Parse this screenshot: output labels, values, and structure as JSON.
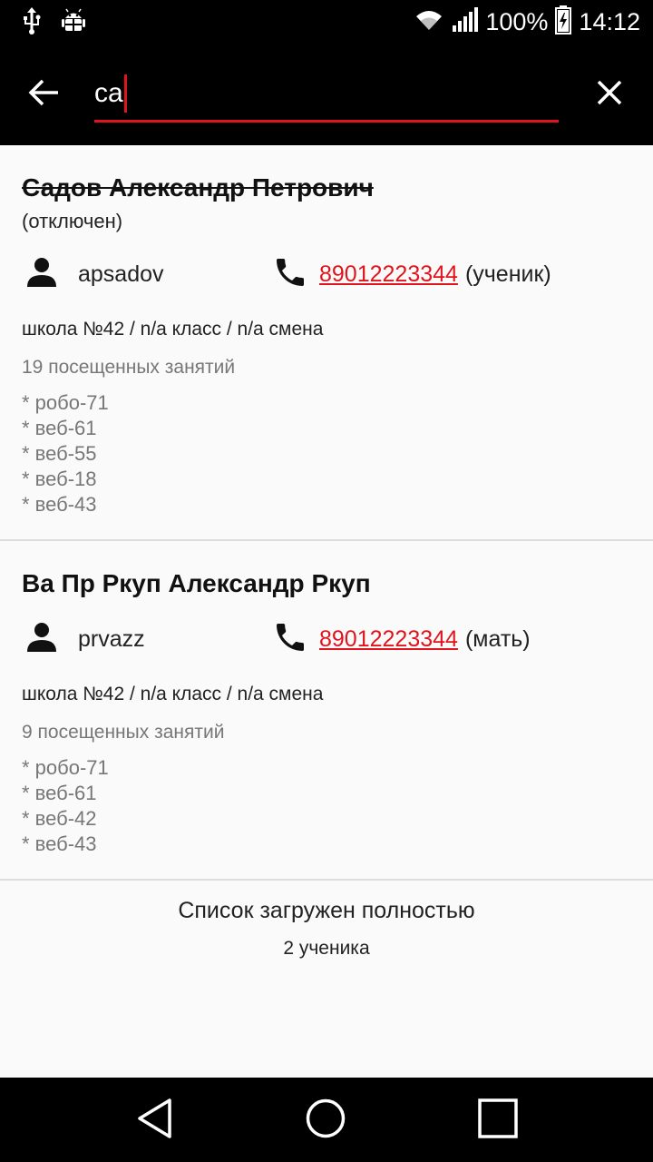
{
  "status_bar": {
    "battery": "100%",
    "time": "14:12",
    "icons": [
      "usb-icon",
      "android-debug-icon",
      "wifi-icon",
      "signal-icon",
      "battery-charging-icon"
    ]
  },
  "toolbar": {
    "search_value": "са",
    "back_icon": "arrow-left-icon",
    "clear_icon": "close-icon"
  },
  "students": [
    {
      "name": "Садов Александр Петрович",
      "disabled_label": "(отключен)",
      "login": "apsadov",
      "phone": "89012223344",
      "phone_role": "(ученик)",
      "school_line": "школа №42 / n/a класс / n/a смена",
      "visits": "19 посещенных занятий",
      "groups": [
        "* робо-71",
        "* веб-61",
        "* веб-55",
        "* веб-18",
        "* веб-43"
      ]
    },
    {
      "name": "Ва Пр Ркуп Александр Ркуп",
      "disabled_label": "",
      "login": "prvazz",
      "phone": "89012223344",
      "phone_role": "(мать)",
      "school_line": "школа №42 / n/a класс / n/a смена",
      "visits": "9 посещенных занятий",
      "groups": [
        "* робо-71",
        "* веб-61",
        "* веб-42",
        "* веб-43"
      ]
    }
  ],
  "footer": {
    "title": "Список загружен полностью",
    "count": "2 ученика"
  },
  "nav_bar": {
    "icons": [
      "nav-back-icon",
      "nav-home-icon",
      "nav-recents-icon"
    ]
  },
  "colors": {
    "accent": "#e0141c",
    "bar_bg": "#000000",
    "content_bg": "#fafafa",
    "secondary_text": "#777777"
  }
}
